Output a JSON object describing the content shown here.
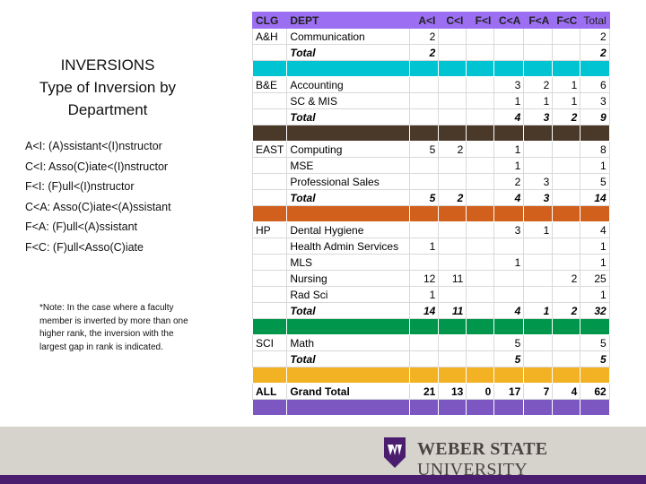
{
  "title": {
    "line1": "INVERSIONS",
    "line2": "Type of Inversion by",
    "line3": "Department"
  },
  "legend": [
    "A<I: (A)ssistant<(I)nstructor",
    "C<I: Asso(C)iate<(I)nstructor",
    "F<I: (F)ull<(I)nstructor",
    "C<A: Asso(C)iate<(A)ssistant",
    "F<A:  (F)ull<(A)ssistant",
    "F<C: (F)ull<Asso(C)iate"
  ],
  "note": "*Note:  In the case where a faculty member is inverted by more than one higher rank, the inversion with the largest gap in rank is indicated.",
  "table": {
    "headers": [
      "CLG",
      "DEPT",
      "A<I",
      "C<I",
      "F<I",
      "C<A",
      "F<A",
      "F<C",
      "Total"
    ],
    "rows": [
      {
        "type": "row",
        "cells": [
          "A&H",
          "Communication",
          "2",
          "",
          "",
          "",
          "",
          "",
          "2"
        ]
      },
      {
        "type": "sub",
        "cells": [
          "",
          "Total",
          "2",
          "",
          "",
          "",
          "",
          "",
          "2"
        ]
      },
      {
        "type": "sep",
        "color": "#00c4d2"
      },
      {
        "type": "row",
        "cells": [
          "B&E",
          "Accounting",
          "",
          "",
          "",
          "3",
          "2",
          "1",
          "6"
        ]
      },
      {
        "type": "row",
        "cells": [
          "",
          "SC & MIS",
          "",
          "",
          "",
          "1",
          "1",
          "1",
          "3"
        ]
      },
      {
        "type": "sub",
        "cells": [
          "",
          "Total",
          "",
          "",
          "",
          "4",
          "3",
          "2",
          "9"
        ]
      },
      {
        "type": "sep",
        "color": "#4a3829"
      },
      {
        "type": "row",
        "cells": [
          "EAST",
          "Computing",
          "5",
          "2",
          "",
          "1",
          "",
          "",
          "8"
        ]
      },
      {
        "type": "row",
        "cells": [
          "",
          "MSE",
          "",
          "",
          "",
          "1",
          "",
          "",
          "1"
        ]
      },
      {
        "type": "row",
        "cells": [
          "",
          "Professional Sales",
          "",
          "",
          "",
          "2",
          "3",
          "",
          "5"
        ]
      },
      {
        "type": "sub",
        "cells": [
          "",
          "Total",
          "5",
          "2",
          "",
          "4",
          "3",
          "",
          "14"
        ]
      },
      {
        "type": "sep",
        "color": "#d0601c"
      },
      {
        "type": "row",
        "cells": [
          "HP",
          "Dental Hygiene",
          "",
          "",
          "",
          "3",
          "1",
          "",
          "4"
        ]
      },
      {
        "type": "row",
        "cells": [
          "",
          "Health Admin Services",
          "1",
          "",
          "",
          "",
          "",
          "",
          "1"
        ]
      },
      {
        "type": "row",
        "cells": [
          "",
          "MLS",
          "",
          "",
          "",
          "1",
          "",
          "",
          "1"
        ]
      },
      {
        "type": "row",
        "cells": [
          "",
          "Nursing",
          "12",
          "11",
          "",
          "",
          "",
          "2",
          "25"
        ]
      },
      {
        "type": "row",
        "cells": [
          "",
          "Rad Sci",
          "1",
          "",
          "",
          "",
          "",
          "",
          "1"
        ]
      },
      {
        "type": "sub",
        "cells": [
          "",
          "Total",
          "14",
          "11",
          "",
          "4",
          "1",
          "2",
          "32"
        ]
      },
      {
        "type": "sep",
        "color": "#00964b"
      },
      {
        "type": "row",
        "cells": [
          "SCI",
          "Math",
          "",
          "",
          "",
          "5",
          "",
          "",
          "5"
        ]
      },
      {
        "type": "sub",
        "cells": [
          "",
          "Total",
          "",
          "",
          "",
          "5",
          "",
          "",
          "5"
        ]
      },
      {
        "type": "sep",
        "color": "#f3b124"
      },
      {
        "type": "grand",
        "cells": [
          "ALL",
          "Grand Total",
          "21",
          "13",
          "0",
          "17",
          "7",
          "4",
          "62"
        ]
      },
      {
        "type": "sep",
        "color": "#7d57c1"
      }
    ]
  },
  "footer": {
    "brand_bold": "WEBER STATE",
    "brand_light": " UNIVERSITY",
    "logo_letter": "W"
  },
  "colors": {
    "header": "#9c6ff2",
    "footer_bg": "#d6d3cc",
    "footer_bar": "#4b1d6e",
    "logo": "#4b1d6e"
  }
}
